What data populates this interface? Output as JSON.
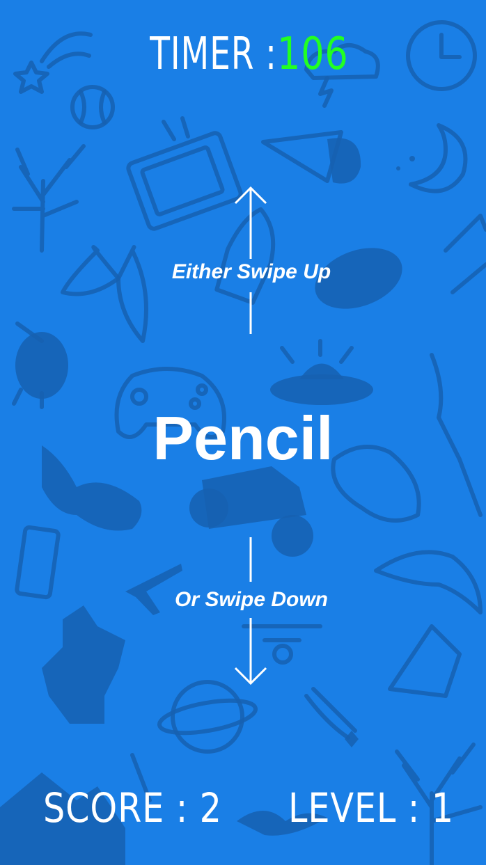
{
  "hud": {
    "timer_label": "TIMER : ",
    "timer_value": "106",
    "score_text": "SCORE : 2",
    "level_text": "LEVEL : 1"
  },
  "prompt": {
    "word": "Pencil",
    "swipe_up_hint": "Either Swipe Up",
    "swipe_down_hint": "Or Swipe Down"
  },
  "colors": {
    "background": "#1a7fe6",
    "doodle": "#1660b0",
    "timer_value": "#22ff22",
    "text": "#ffffff"
  },
  "background_doodles": [
    "shooting-star-icon",
    "baseball-icon",
    "storm-cloud-icon",
    "clock-icon",
    "tree-icon",
    "tv-icon",
    "paper-plane-icon",
    "moon-icon",
    "rocket-icon",
    "bow-icon",
    "football-icon",
    "kiwi-bird-icon",
    "gamepad-icon",
    "ufo-icon",
    "broom-icon",
    "unicorn-icon",
    "monster-truck-icon",
    "car-icon",
    "phone-icon",
    "airplane-icon",
    "dolphin-icon",
    "cartoon-character-icon",
    "drone-icon",
    "spaceship-icon",
    "planet-icon",
    "comet-icon",
    "bat-icon",
    "mountain-icon",
    "eagle-icon",
    "bare-tree-icon"
  ]
}
